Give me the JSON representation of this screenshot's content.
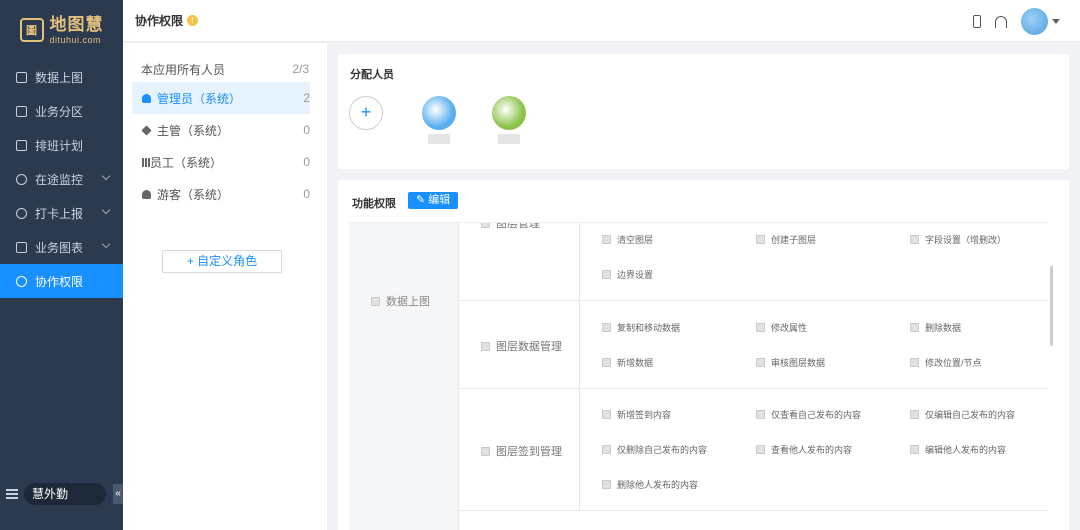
{
  "brand": {
    "mark": "圖",
    "name_cn": "地图慧",
    "name_en": "dituhui.com"
  },
  "nav": [
    {
      "label": "数据上图",
      "icon": "table-icon",
      "active": false,
      "expandable": false
    },
    {
      "label": "业务分区",
      "icon": "grid-icon",
      "active": false,
      "expandable": false
    },
    {
      "label": "排班计划",
      "icon": "calendar-icon",
      "active": false,
      "expandable": false
    },
    {
      "label": "在途监控",
      "icon": "route-icon",
      "active": false,
      "expandable": true
    },
    {
      "label": "打卡上报",
      "icon": "pin-icon",
      "active": false,
      "expandable": true
    },
    {
      "label": "业务图表",
      "icon": "chart-icon",
      "active": false,
      "expandable": true
    },
    {
      "label": "协作权限",
      "icon": "users-icon",
      "active": true,
      "expandable": false
    }
  ],
  "footer": {
    "label": "慧外勤",
    "collapse": "«"
  },
  "topbar": {
    "title": "协作权限",
    "info": "!"
  },
  "roles": {
    "header": {
      "label": "本应用所有人员",
      "count": "2/3"
    },
    "items": [
      {
        "label": "管理员（系统）",
        "count": "2",
        "active": true
      },
      {
        "label": "主管（系统）",
        "count": "0",
        "active": false
      },
      {
        "label": "员工（系统）",
        "count": "0",
        "active": false
      },
      {
        "label": "游客（系统）",
        "count": "0",
        "active": false
      }
    ],
    "custom_button": "+ 自定义角色"
  },
  "members": {
    "title": "分配人员",
    "add": "+",
    "people": [
      {
        "color": "#5aaef0"
      },
      {
        "color": "#8bc34a"
      }
    ]
  },
  "permissions": {
    "title": "功能权限",
    "edit": "✎ 编辑",
    "category": "数据上图",
    "clipped_group": "图层管理",
    "row0": [
      "清空图层",
      "创建子图层",
      "字段设置（增删改）",
      "边界设置"
    ],
    "groups": [
      {
        "name": "图层数据管理",
        "items": [
          "复制和移动数据",
          "修改属性",
          "删除数据",
          "新增数据",
          "审核图层数据",
          "修改位置/节点"
        ]
      },
      {
        "name": "图层签到管理",
        "items": [
          "新增签到内容",
          "仅查看自己发布的内容",
          "仅编辑自己发布的内容",
          "仅删除自己发布的内容",
          "查看他人发布的内容",
          "编辑他人发布的内容",
          "删除他人发布的内容"
        ]
      }
    ]
  },
  "colors": {
    "accent": "#1890ff",
    "sidebar": "#2b3a4f",
    "brand": "#e3c07b"
  }
}
